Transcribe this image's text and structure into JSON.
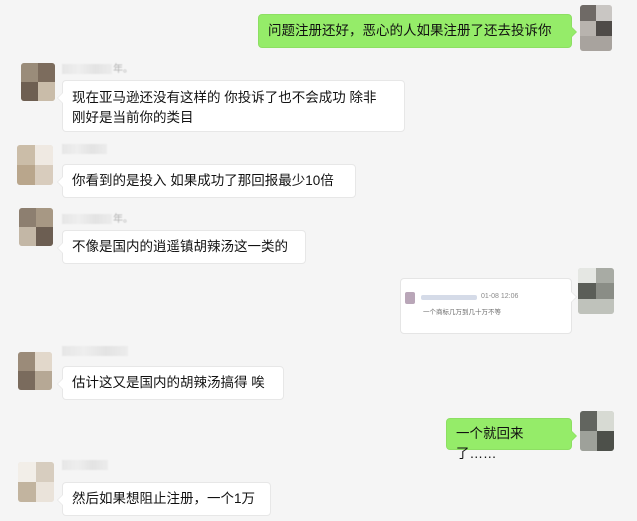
{
  "colors": {
    "background": "#f5f5f5",
    "bubble_incoming": "#ffffff",
    "bubble_outgoing": "#95ec69"
  },
  "messages": [
    {
      "side": "right",
      "sender_name": "",
      "text": "问题注册还好，恶心的人如果注册了还去投诉你"
    },
    {
      "side": "left",
      "sender_name": "年。",
      "text": "现在亚马逊还没有这样的  你投诉了也不会成功  除非\n刚好是当前你的类目"
    },
    {
      "side": "left",
      "sender_name": "",
      "text": "你看到的是投入  如果成功了那回报最少10倍"
    },
    {
      "side": "left",
      "sender_name": "年。",
      "text": "不像是国内的逍遥镇胡辣汤这一类的"
    },
    {
      "side": "right",
      "card": {
        "date": "01-08 12:06",
        "subtitle": "一个商标几万到几十万不等"
      }
    },
    {
      "side": "left",
      "sender_name": "",
      "text": "估计这又是国内的胡辣汤搞得  唉"
    },
    {
      "side": "right",
      "sender_name": "",
      "text": "一个就回来了……"
    },
    {
      "side": "left",
      "sender_name": "",
      "text": "然后如果想阻止注册，一个1万"
    }
  ]
}
